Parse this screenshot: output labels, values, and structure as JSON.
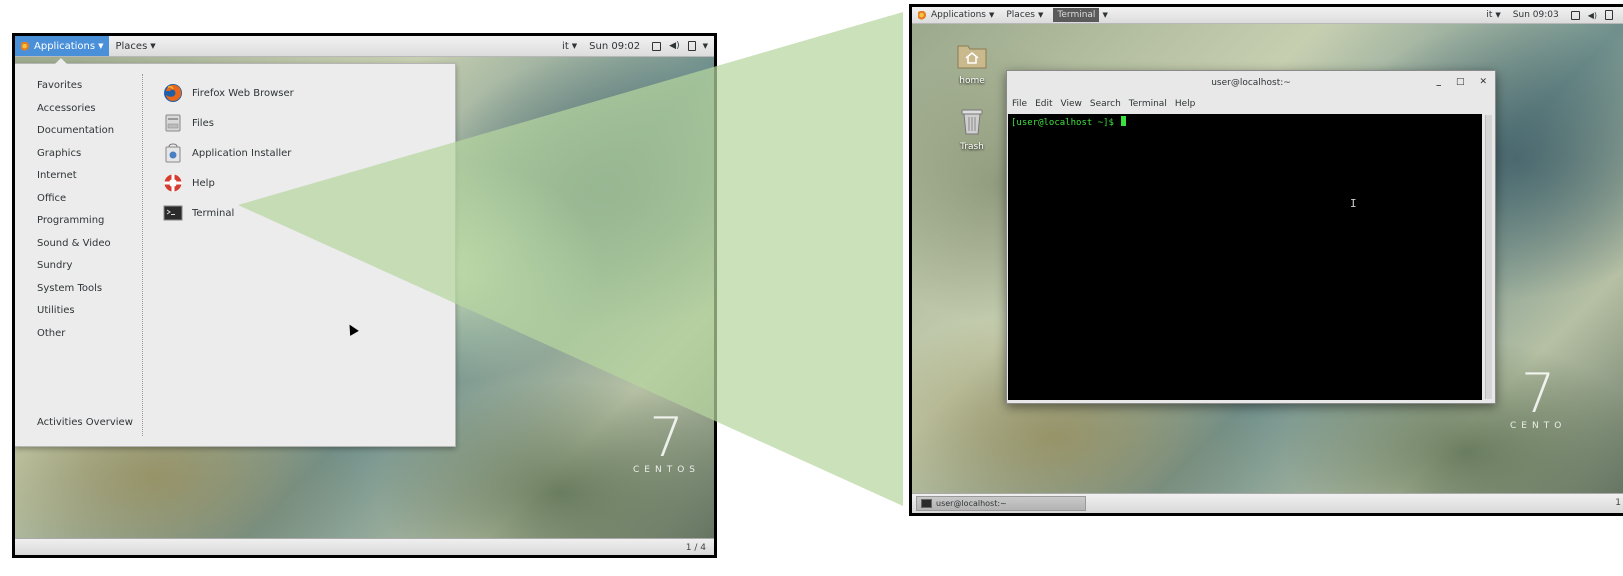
{
  "left_screen": {
    "top_panel": {
      "applications_label": "Applications",
      "places_label": "Places",
      "keyboard_layout": "it",
      "clock": "Sun 09:02"
    },
    "menu": {
      "categories": [
        {
          "label": "Favorites"
        },
        {
          "label": "Accessories"
        },
        {
          "label": "Documentation"
        },
        {
          "label": "Graphics"
        },
        {
          "label": "Internet"
        },
        {
          "label": "Office"
        },
        {
          "label": "Programming"
        },
        {
          "label": "Sound & Video"
        },
        {
          "label": "Sundry"
        },
        {
          "label": "System Tools"
        },
        {
          "label": "Utilities"
        },
        {
          "label": "Other"
        }
      ],
      "activities_label": "Activities Overview",
      "apps": [
        {
          "label": "Firefox Web Browser",
          "icon": "firefox-icon"
        },
        {
          "label": "Files",
          "icon": "files-icon"
        },
        {
          "label": "Application Installer",
          "icon": "application-installer-icon"
        },
        {
          "label": "Help",
          "icon": "help-lifebuoy-icon"
        },
        {
          "label": "Terminal",
          "icon": "terminal-icon"
        }
      ]
    },
    "workspace_indicator": "1 / 4",
    "branding": {
      "number": "7",
      "word": "CENTOS"
    }
  },
  "right_screen": {
    "top_panel": {
      "applications_label": "Applications",
      "places_label": "Places",
      "active_app_label": "Terminal",
      "keyboard_layout": "it",
      "clock": "Sun 09:03"
    },
    "desktop_icons": [
      {
        "label": "home",
        "icon": "home-folder-icon"
      },
      {
        "label": "Trash",
        "icon": "trash-icon"
      }
    ],
    "terminal": {
      "title": "user@localhost:~",
      "menu": [
        "File",
        "Edit",
        "View",
        "Search",
        "Terminal",
        "Help"
      ],
      "prompt": "[user@localhost ~]$ "
    },
    "taskbar_item": "user@localhost:~",
    "workspace_indicator": "1",
    "branding": {
      "number": "7",
      "word": "CENTO"
    }
  },
  "colors": {
    "panel_active": "#4a90d9",
    "zoom_wedge": "#b5d6a0",
    "terminal_green": "#3ee03e"
  }
}
